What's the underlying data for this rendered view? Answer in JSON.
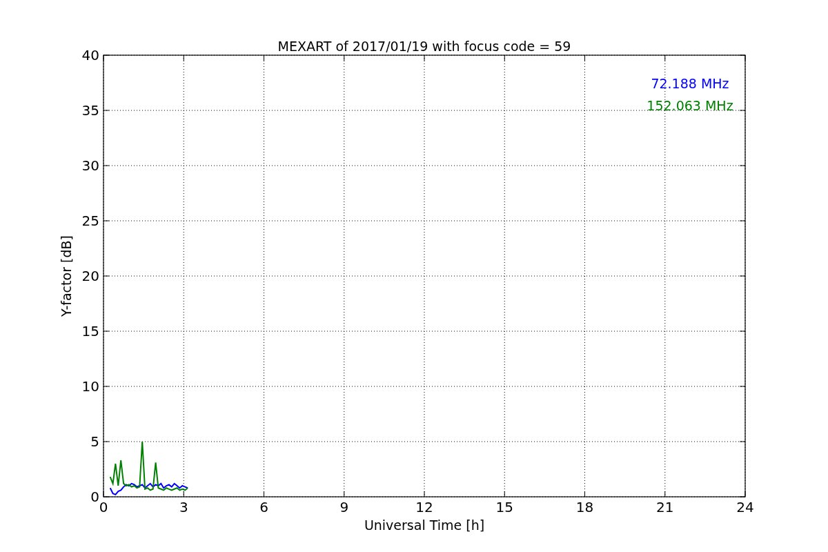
{
  "chart_data": {
    "type": "line",
    "title": "MEXART of 2017/01/19 with focus code = 59",
    "xlabel": "Universal Time [h]",
    "ylabel": "Y-factor [dB]",
    "grid": true,
    "xlim": [
      0,
      24
    ],
    "ylim": [
      0,
      40
    ],
    "xticks": [
      0,
      3,
      6,
      9,
      12,
      15,
      18,
      21,
      24
    ],
    "yticks": [
      0,
      5,
      10,
      15,
      20,
      25,
      30,
      35,
      40
    ],
    "x": [
      0.25,
      0.35,
      0.45,
      0.55,
      0.65,
      0.75,
      0.85,
      0.95,
      1.05,
      1.15,
      1.25,
      1.35,
      1.45,
      1.55,
      1.65,
      1.75,
      1.85,
      1.95,
      2.05,
      2.15,
      2.25,
      2.35,
      2.45,
      2.55,
      2.65,
      2.75,
      2.85,
      2.95,
      3.05,
      3.15
    ],
    "series": [
      {
        "name": "72.188 MHz",
        "color": "#0000ff",
        "values": [
          0.8,
          0.3,
          0.2,
          0.5,
          0.6,
          0.9,
          1.1,
          1.0,
          1.2,
          1.1,
          0.9,
          1.0,
          1.1,
          0.8,
          1.0,
          1.2,
          0.9,
          1.1,
          1.0,
          1.2,
          0.8,
          1.0,
          1.1,
          0.9,
          1.2,
          1.0,
          0.8,
          1.0,
          0.9,
          0.8
        ]
      },
      {
        "name": "152.063 MHz",
        "color": "#008000",
        "values": [
          1.8,
          1.2,
          3.0,
          1.0,
          3.3,
          1.2,
          1.0,
          1.1,
          0.9,
          1.0,
          0.8,
          0.9,
          5.0,
          0.7,
          0.8,
          0.6,
          0.7,
          3.1,
          0.8,
          0.7,
          0.6,
          0.8,
          0.7,
          0.6,
          0.7,
          0.8,
          0.6,
          0.7,
          0.6,
          0.8
        ]
      }
    ]
  }
}
